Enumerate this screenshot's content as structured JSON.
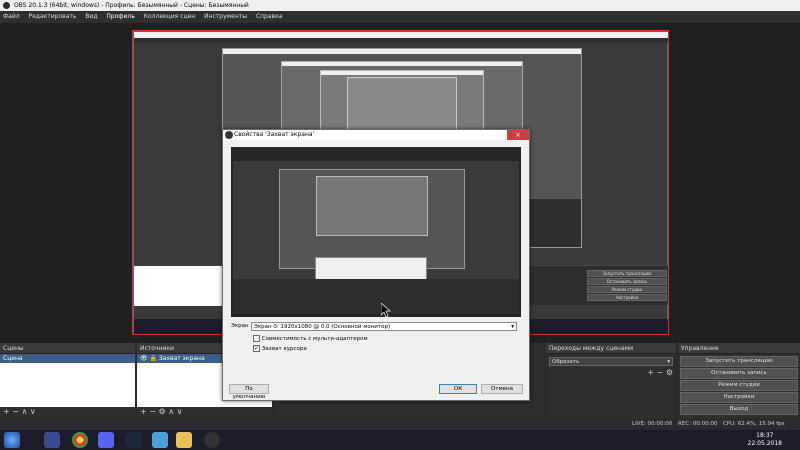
{
  "window": {
    "title": "OBS 20.1.3 (64bit, windows) - Профиль: Безымянный - Сцены: Безымянный"
  },
  "menu": [
    "Файл",
    "Редактировать",
    "Вид",
    "Профиль",
    "Коллекция сцен",
    "Инструменты",
    "Справка"
  ],
  "panels": {
    "scenes": {
      "header": "Сцены",
      "items": [
        "Сцена"
      ]
    },
    "sources": {
      "header": "Источники",
      "items": [
        "Захват экрана"
      ]
    },
    "transitions": {
      "header": "Переходы между сценами",
      "selected": "Обрезать"
    },
    "controls": {
      "header": "Управление",
      "buttons": [
        "Запустить трансляцию",
        "Остановить запись",
        "Режим студии",
        "Настройки",
        "Выход"
      ]
    }
  },
  "toolbar_glyphs": {
    "add": "+",
    "remove": "−",
    "up": "∧",
    "down": "∨",
    "gear": "⚙"
  },
  "status": {
    "live": "LIVE: 00:00:00",
    "rec": "REC: 00:00:00",
    "cpu": "CPU: 62.4%, 15.94 fps"
  },
  "dialog": {
    "title": "Свойства 'Захват экрана'",
    "close": "×",
    "screen_label": "Экран",
    "screen_value": "Экран 0: 1920x1080 @ 0,0 (Основной монитор)",
    "multi_adapter": {
      "label": "Совместимость с мульти-адаптером",
      "checked": false
    },
    "capture_cursor": {
      "label": "Захват курсора",
      "checked": true,
      "mark": "✓"
    },
    "defaults_button": "По умолчанию",
    "ok_button": "ОК",
    "cancel_button": "Отмена"
  },
  "taskbar": {
    "time": "18:37",
    "date": "22.05.2018"
  },
  "colors": {
    "accent": "#c33333",
    "selection": "#3c5f8a"
  }
}
